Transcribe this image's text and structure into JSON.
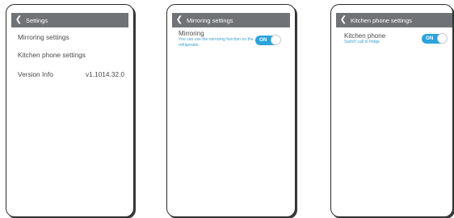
{
  "screens": {
    "settings": {
      "title": "Settings",
      "items": [
        {
          "label": "Mirroring settings"
        },
        {
          "label": "Kitchen phone settings"
        }
      ],
      "version": {
        "label": "Version Info",
        "value": "v1.1014.32.0"
      }
    },
    "mirroring": {
      "title": "Mirroring settings",
      "setting": {
        "title": "Mirroring",
        "description": "You can use the mirroring function on the refrigerator.",
        "toggle_label": "ON",
        "enabled": true
      }
    },
    "kitchen_phone": {
      "title": "Kitchen phone settings",
      "setting": {
        "title": "Kitchen phone",
        "description": "Switch call to fridge",
        "toggle_label": "ON",
        "enabled": true
      }
    }
  },
  "icons": {
    "back": "chevron-left-icon"
  },
  "colors": {
    "header_bg": "#6f7377",
    "header_text": "#ffffff",
    "toggle_on": "#2aa3dc",
    "description_text": "#3b9fd4",
    "body_text": "#4a4a4a"
  }
}
